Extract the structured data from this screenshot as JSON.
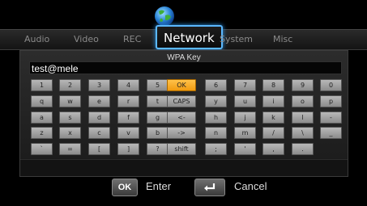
{
  "menu": {
    "tabs": [
      {
        "label": "Audio"
      },
      {
        "label": "Video"
      },
      {
        "label": "REC"
      },
      {
        "label": "Network"
      },
      {
        "label": "System"
      },
      {
        "label": "Misc"
      }
    ],
    "active_tab": "Network",
    "icon": "globe-icon"
  },
  "dialog": {
    "title": "WPA Key",
    "input_value": "test@mele"
  },
  "keyboard": {
    "rows": [
      [
        "1",
        "2",
        "3",
        "4",
        "5",
        "OK",
        "6",
        "7",
        "8",
        "9",
        "0"
      ],
      [
        "q",
        "w",
        "e",
        "r",
        "t",
        "CAPS",
        "y",
        "u",
        "i",
        "o",
        "p"
      ],
      [
        "a",
        "s",
        "d",
        "f",
        "g",
        "<-",
        "h",
        "j",
        "k",
        "l",
        "-"
      ],
      [
        "z",
        "x",
        "c",
        "v",
        "b",
        "->",
        "n",
        "m",
        "/",
        "\\",
        "_"
      ],
      [
        "`",
        "=",
        "[",
        "]",
        "?",
        "shift",
        ";",
        "'",
        ",",
        "."
      ]
    ],
    "selected_key": "OK"
  },
  "hints": {
    "ok_button": "OK",
    "ok_label": "Enter",
    "back_icon": "return-arrow-icon",
    "back_label": "Cancel"
  },
  "colors": {
    "highlight": "#5bb8ff",
    "selected_key": "#f0a020"
  }
}
